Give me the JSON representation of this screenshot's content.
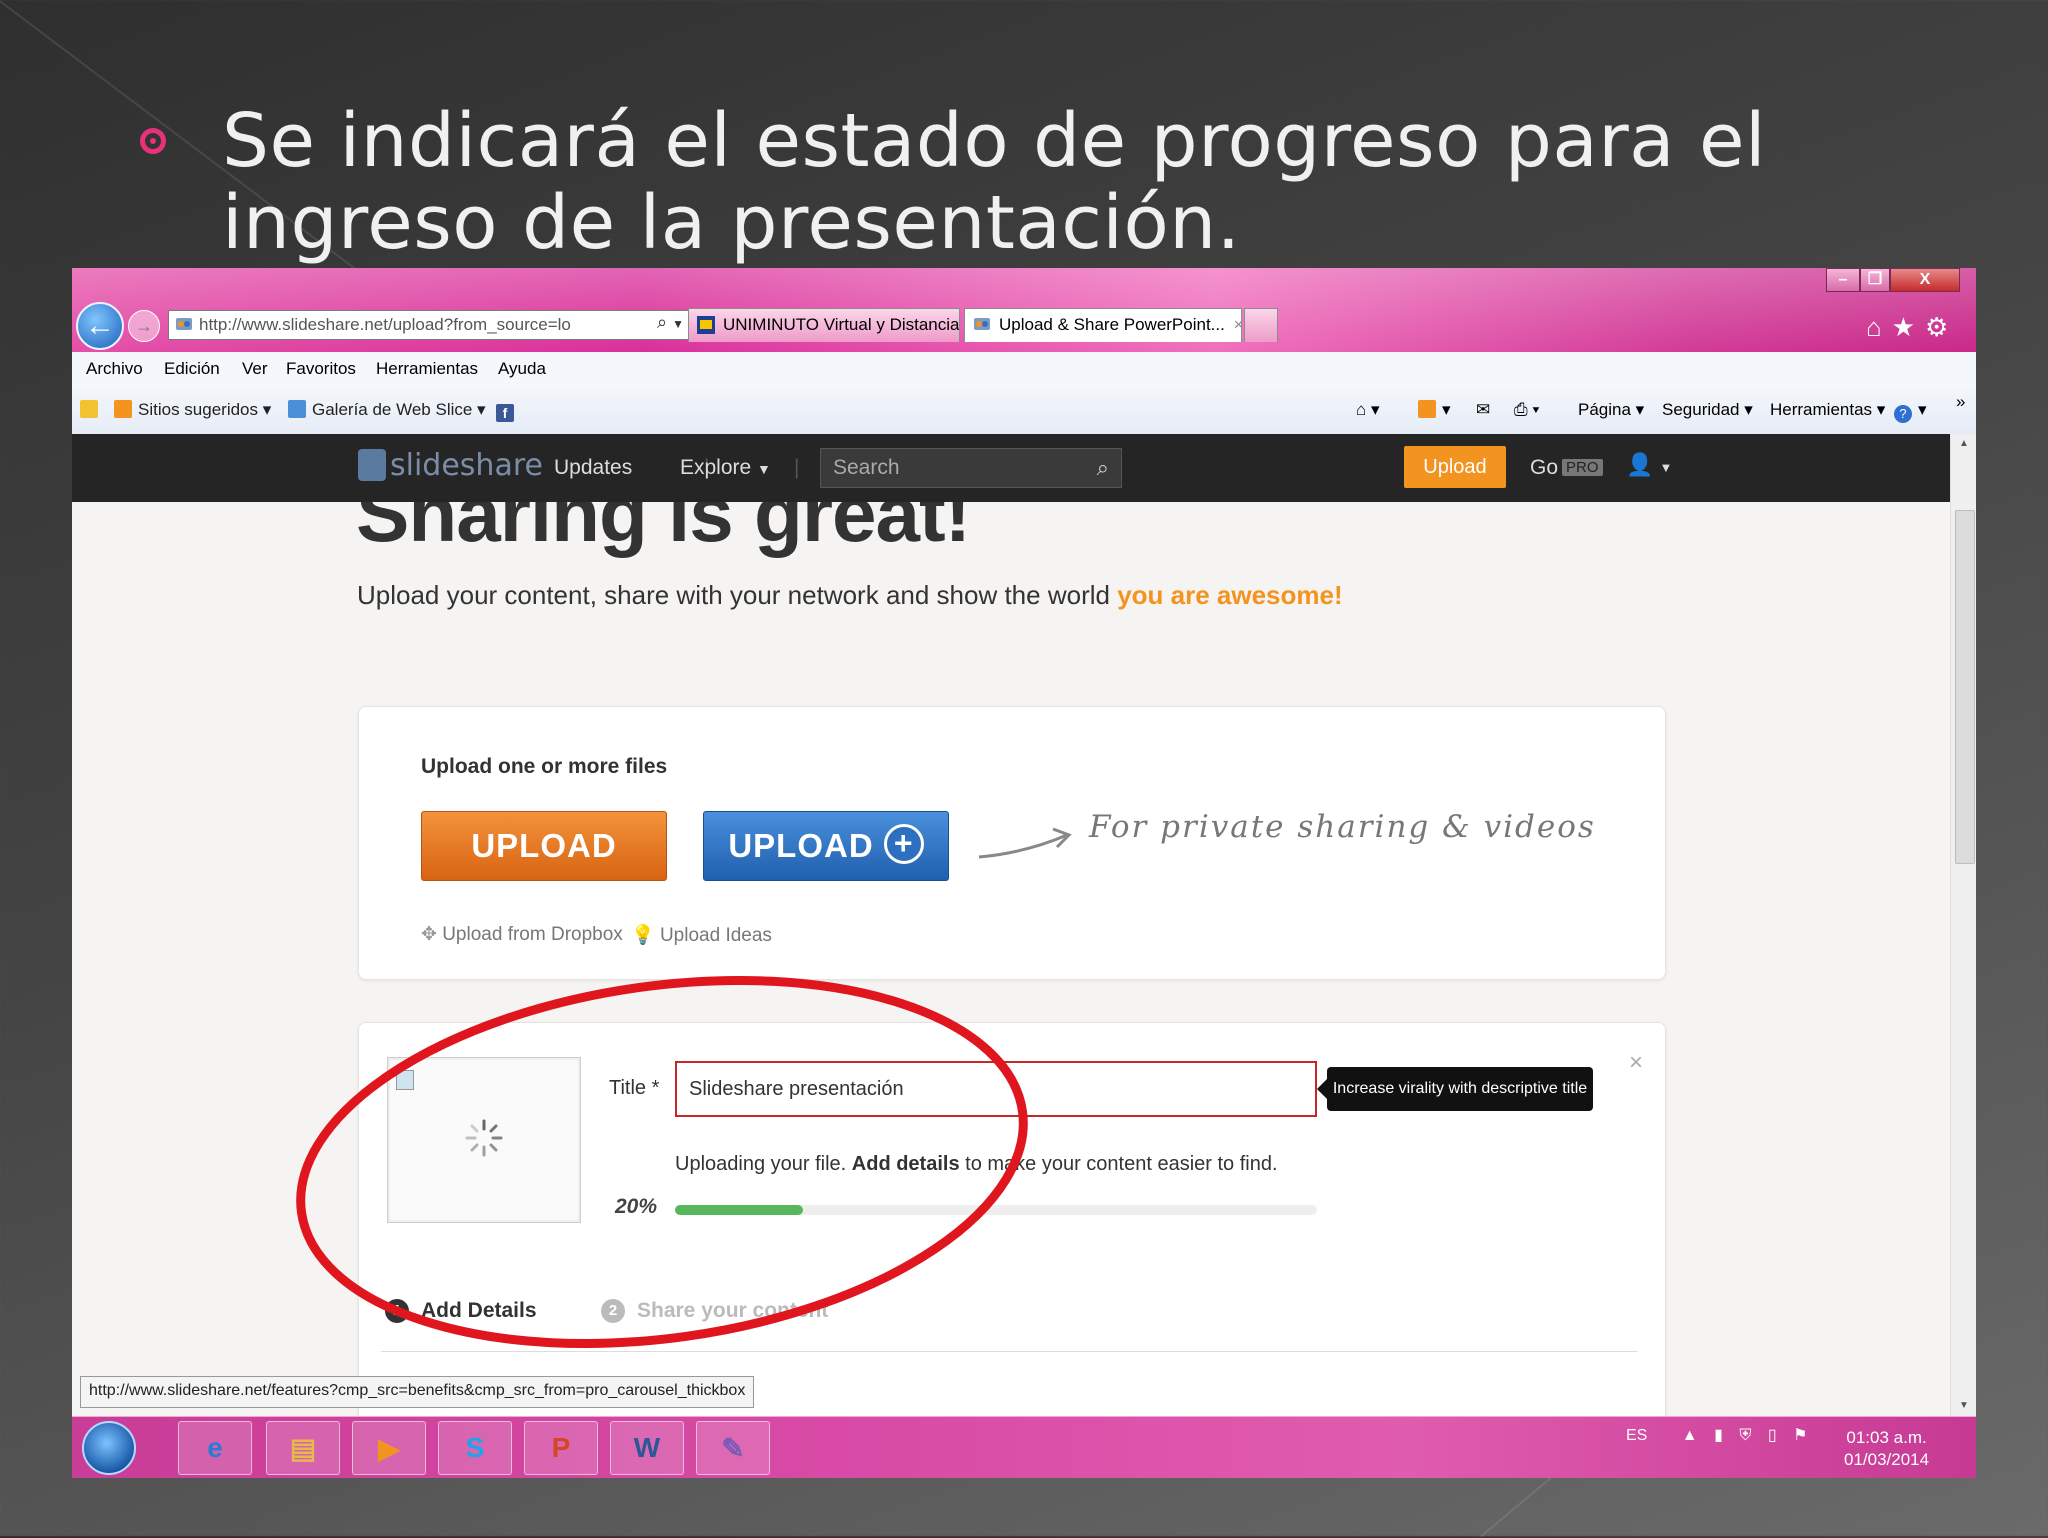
{
  "slide": {
    "bullet_text": "Se indicará el estado de progreso para el ingreso de la presentación."
  },
  "window_controls": {
    "minimize": "–",
    "restore": "❐",
    "close": "X"
  },
  "browser": {
    "address": "http://www.slideshare.net/upload?from_source=lo",
    "tabs": [
      {
        "label": "UNIMINUTO Virtual y Distancia"
      },
      {
        "label": "Upload & Share PowerPoint...",
        "close": "×"
      }
    ],
    "menu": [
      "Archivo",
      "Edición",
      "Ver",
      "Favoritos",
      "Herramientas",
      "Ayuda"
    ],
    "favorites": [
      {
        "label": "Sitios sugeridos"
      },
      {
        "label": "Galería de Web Slice"
      }
    ],
    "commands": [
      "Página",
      "Seguridad",
      "Herramientas"
    ],
    "status_url": "http://www.slideshare.net/features?cmp_src=benefits&cmp_src_from=pro_carousel_thickbox"
  },
  "slideshare": {
    "logo": "slideshare",
    "nav": [
      "Updates",
      "Explore"
    ],
    "search_placeholder": "Search",
    "upload_button": "Upload",
    "go_label": "Go",
    "pro_badge": "PRO",
    "headline": "Sharing is great!",
    "subline": "Upload your content, share with your network and show the world",
    "subline_highlight": "you are awesome!",
    "upload_section_label": "Upload one or more files",
    "upload_btn": "UPLOAD",
    "upload_plus_btn": "UPLOAD",
    "private_text": "For private sharing & videos",
    "dropbox_link": "Upload from Dropbox",
    "ideas_link": "Upload Ideas",
    "title_label": "Title *",
    "title_value": "Slideshare presentación",
    "tooltip": "Increase virality with descriptive title",
    "status_prefix": "Uploading your file.",
    "status_bold": "Add details",
    "status_suffix": "to make your content easier to find.",
    "progress_text": "20%",
    "progress_value": 0.2,
    "steps": [
      {
        "num": "1",
        "label": "Add Details"
      },
      {
        "num": "2",
        "label": "Share your content"
      }
    ]
  },
  "taskbar": {
    "lang": "ES",
    "time": "01:03 a.m.",
    "date": "01/03/2014"
  },
  "colors": {
    "accent_pink": "#e8317a",
    "slideshare_orange": "#f39320",
    "upload_blue": "#1f5fae",
    "progress_green": "#56b85a",
    "annotation_red": "#e0161f"
  }
}
